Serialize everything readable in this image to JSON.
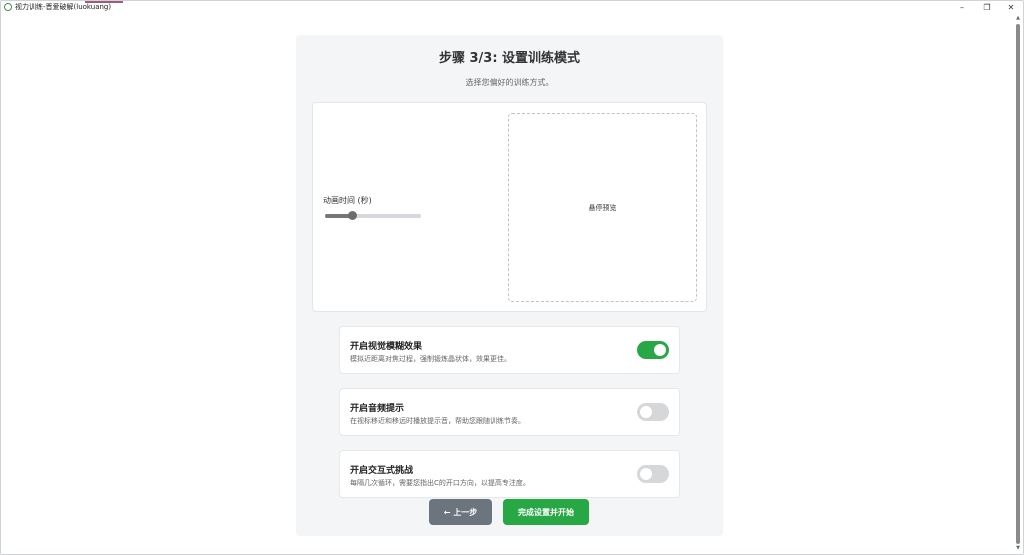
{
  "window": {
    "title": "视力训练-晋爱破解(luokuang)",
    "minimize": "–",
    "restore": "❐",
    "close": "✕"
  },
  "step": {
    "title": "步骤 3/3: 设置训练模式",
    "subtitle": "选择您偏好的训练方式。"
  },
  "preview": {
    "anim_label": "动画时间 (秒)",
    "slider_fraction": 0.28,
    "hover_label": "悬停预览"
  },
  "options": [
    {
      "title": "开启视觉模糊效果",
      "desc": "模拟近距离对焦过程，强制锻炼晶状体，效果更佳。",
      "enabled": true
    },
    {
      "title": "开启音频提示",
      "desc": "在视标移近和移远时播放提示音，帮助您跟随训练节奏。",
      "enabled": false
    },
    {
      "title": "开启交互式挑战",
      "desc": "每隔几次循环，需要您指出C的开口方向，以提高专注度。",
      "enabled": false
    }
  ],
  "buttons": {
    "prev": "← 上一步",
    "finish": "完成设置并开始"
  },
  "colors": {
    "accent_green": "#28a745",
    "secondary_gray": "#6c757d"
  }
}
